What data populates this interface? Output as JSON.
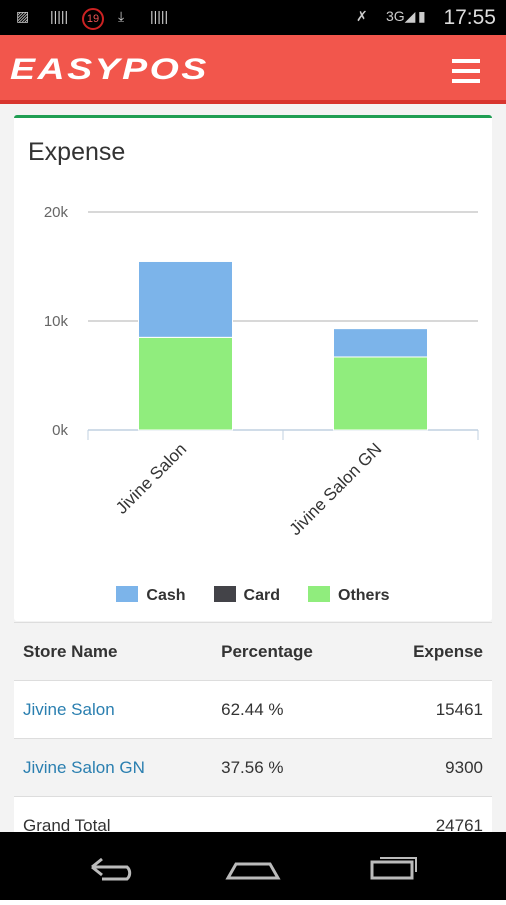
{
  "status": {
    "time": "17:55",
    "notification_count": "19"
  },
  "app": {
    "logo": "EASYPOS",
    "menu_icon": "hamburger-icon",
    "brand_color": "#f2564c"
  },
  "card": {
    "title": "Expense"
  },
  "chart_data": {
    "type": "bar",
    "stacked": true,
    "categories": [
      "Jivine Salon",
      "Jivine Salon GN"
    ],
    "series": [
      {
        "name": "Cash",
        "color": "#7cb4ea",
        "values": [
          6961,
          2600
        ]
      },
      {
        "name": "Card",
        "color": "#434348",
        "values": [
          0,
          0
        ]
      },
      {
        "name": "Others",
        "color": "#90ed7d",
        "values": [
          8500,
          6700
        ]
      }
    ],
    "ylim": [
      0,
      20000
    ],
    "yticks": [
      "0k",
      "10k",
      "20k"
    ],
    "grid": true,
    "legend": "bottom"
  },
  "table": {
    "headers": [
      "Store Name",
      "Percentage",
      "Expense"
    ],
    "rows": [
      {
        "store": "Jivine Salon",
        "pct": "62.44 %",
        "expense": "15461"
      },
      {
        "store": "Jivine Salon GN",
        "pct": "37.56 %",
        "expense": "9300"
      }
    ],
    "total": {
      "label": "Grand Total",
      "expense": "24761"
    }
  }
}
